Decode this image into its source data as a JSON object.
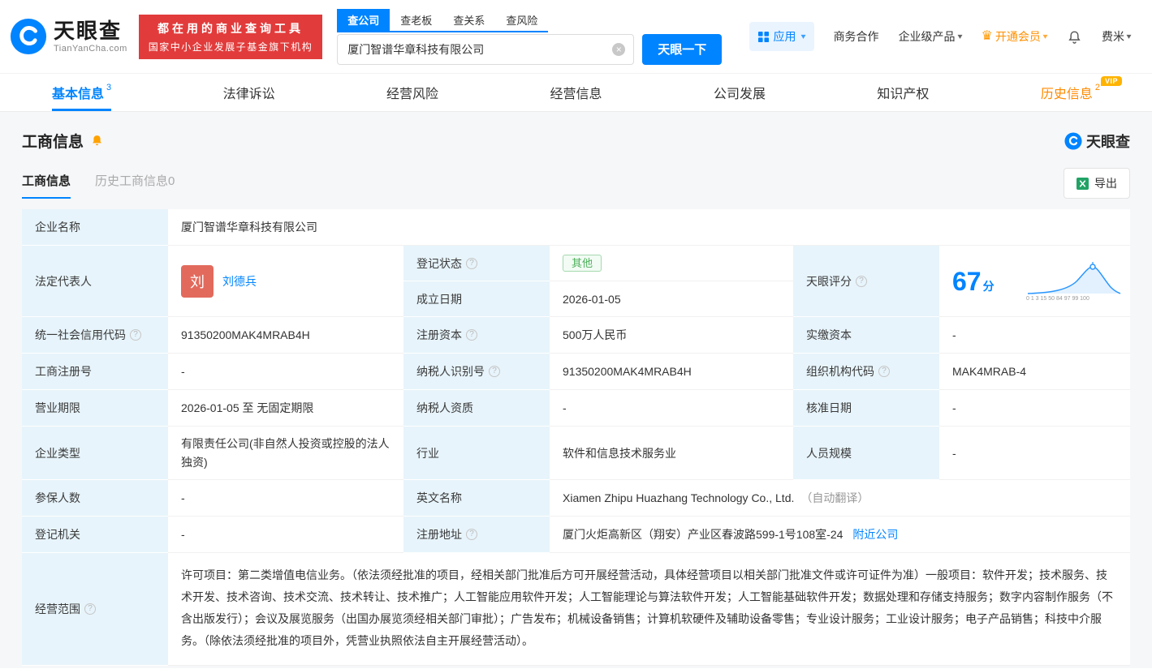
{
  "icons": {
    "caret": "▾",
    "crown": "♛",
    "close": "×",
    "question": "?"
  },
  "header": {
    "logo": {
      "brand": "天眼查",
      "domain": "TianYanCha.com"
    },
    "promo": {
      "line1": "都在用的商业查询工具",
      "line2": "国家中小企业发展子基金旗下机构"
    },
    "search_tabs": [
      {
        "label": "查公司"
      },
      {
        "label": "查老板"
      },
      {
        "label": "查关系"
      },
      {
        "label": "查风险"
      }
    ],
    "search": {
      "value": "厦门智谱华章科技有限公司",
      "button": "天眼一下"
    },
    "menu": {
      "apps": "应用",
      "cooperation": "商务合作",
      "enterprise": "企业级产品",
      "vip": "开通会员",
      "user": "费米"
    }
  },
  "nav": {
    "tabs": [
      {
        "label": "基本信息",
        "count": "3"
      },
      {
        "label": "法律诉讼"
      },
      {
        "label": "经营风险"
      },
      {
        "label": "经营信息"
      },
      {
        "label": "公司发展"
      },
      {
        "label": "知识产权"
      },
      {
        "label": "历史信息",
        "count": "2",
        "badge": "VIP"
      }
    ]
  },
  "section": {
    "title": "工商信息",
    "brand": "天眼查",
    "tabs": [
      {
        "label": "工商信息"
      },
      {
        "label": "历史工商信息0"
      }
    ],
    "export_label": "导出"
  },
  "table": {
    "company_name": {
      "label": "企业名称",
      "value": "厦门智谱华章科技有限公司"
    },
    "legal_rep": {
      "label": "法定代表人",
      "avatar": "刘",
      "name": "刘德兵"
    },
    "reg_status": {
      "label": "登记状态",
      "value": "其他"
    },
    "establish_date": {
      "label": "成立日期",
      "value": "2026-01-05"
    },
    "score": {
      "label": "天眼评分",
      "value": "67",
      "unit": "分",
      "axis": "0 1 3 15 50 84 97 99 100"
    },
    "credit_code": {
      "label": "统一社会信用代码",
      "value": "91350200MAK4MRAB4H"
    },
    "reg_capital": {
      "label": "注册资本",
      "value": "500万人民币"
    },
    "paid_capital": {
      "label": "实缴资本",
      "value": "-"
    },
    "reg_number": {
      "label": "工商注册号",
      "value": "-"
    },
    "taxpayer_id": {
      "label": "纳税人识别号",
      "value": "91350200MAK4MRAB4H"
    },
    "org_code": {
      "label": "组织机构代码",
      "value": "MAK4MRAB-4"
    },
    "business_term": {
      "label": "营业期限",
      "value": "2026-01-05 至 无固定期限"
    },
    "taxpayer_quality": {
      "label": "纳税人资质",
      "value": "-"
    },
    "approval_date": {
      "label": "核准日期",
      "value": "-"
    },
    "company_type": {
      "label": "企业类型",
      "value": "有限责任公司(非自然人投资或控股的法人独资)"
    },
    "industry": {
      "label": "行业",
      "value": "软件和信息技术服务业"
    },
    "staff_size": {
      "label": "人员规模",
      "value": "-"
    },
    "insured_count": {
      "label": "参保人数",
      "value": "-"
    },
    "english_name": {
      "label": "英文名称",
      "value": "Xiamen Zhipu Huazhang Technology Co., Ltd.",
      "note": "（自动翻译）"
    },
    "reg_authority": {
      "label": "登记机关",
      "value": "-"
    },
    "reg_address": {
      "label": "注册地址",
      "value": "厦门火炬高新区（翔安）产业区春波路599-1号108室-24",
      "link": "附近公司"
    },
    "business_scope": {
      "label": "经营范围",
      "value": "许可项目：第二类增值电信业务。（依法须经批准的项目，经相关部门批准后方可开展经营活动，具体经营项目以相关部门批准文件或许可证件为准）一般项目：软件开发；技术服务、技术开发、技术咨询、技术交流、技术转让、技术推广；人工智能应用软件开发；人工智能理论与算法软件开发；人工智能基础软件开发；数据处理和存储支持服务；数字内容制作服务（不含出版发行）；会议及展览服务（出国办展览须经相关部门审批）；广告发布；机械设备销售；计算机软硬件及辅助设备零售；专业设计服务；工业设计服务；电子产品销售；科技中介服务。（除依法须经批准的项目外，凭营业执照依法自主开展经营活动）。"
    }
  }
}
